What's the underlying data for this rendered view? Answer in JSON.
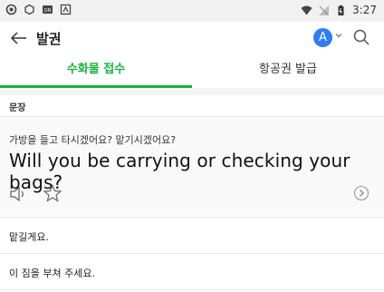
{
  "status_bar": {
    "time": "3:27",
    "left_icons": [
      "notification-icon",
      "app-icon",
      "badge-icon",
      "alert-icon"
    ],
    "right_icons": [
      "wifi-icon",
      "signal-icon",
      "battery-icon"
    ]
  },
  "app_bar": {
    "title": "발권",
    "avatar_letter": "A"
  },
  "tabs": [
    {
      "label": "수화물 접수",
      "active": true
    },
    {
      "label": "항공권 발급",
      "active": false
    }
  ],
  "section": {
    "label": "문장",
    "korean": "가방을 들고 타시겠어요? 맡기시겠어요?",
    "english": "Will you be carrying or checking your bags?"
  },
  "list": [
    {
      "text": "맡길게요."
    },
    {
      "text": "이 짐을 부쳐 주세요."
    }
  ],
  "colors": {
    "accent": "#16b33c",
    "avatar": "#2f7cf6"
  }
}
